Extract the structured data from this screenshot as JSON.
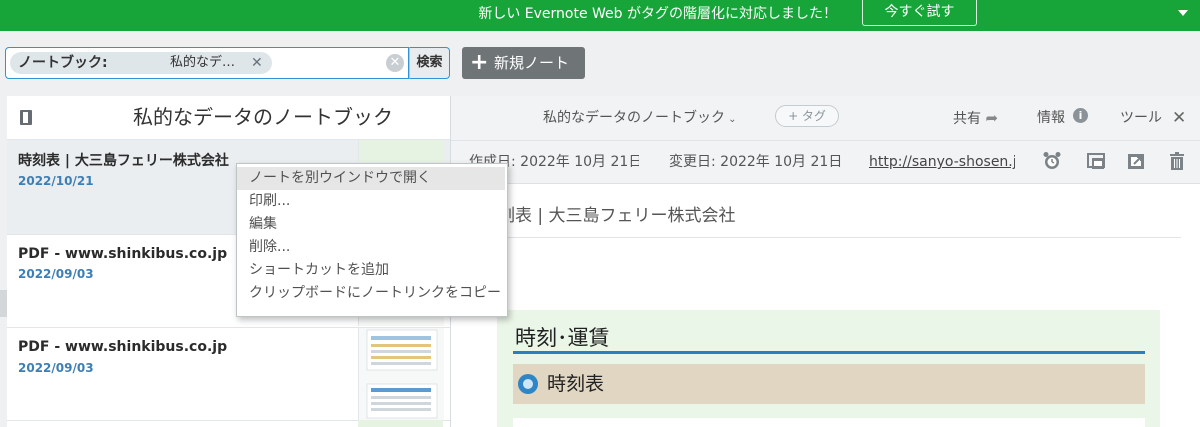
{
  "banner": {
    "message": "新しい Evernote Web がタグの階層化に対応しました！",
    "try_button": "今すぐ試す"
  },
  "toolbar": {
    "filter_key": "ノートブック:",
    "filter_value": "私的なデ…",
    "search_button": "検索",
    "new_note_label": "新規ノート"
  },
  "notebook": {
    "title": "私的なデータのノートブック"
  },
  "notes": [
    {
      "title": "時刻表 | 大三島フェリー株式会社",
      "date": "2022/10/21"
    },
    {
      "title": "PDF - www.shinkibus.co.jp",
      "date": "2022/09/03"
    },
    {
      "title": "PDF - www.shinkibus.co.jp",
      "date": "2022/09/03"
    }
  ],
  "context_menu": [
    "ノートを別ウインドウで開く",
    "印刷...",
    "編集",
    "削除...",
    "ショートカットを追加",
    "クリップボードにノートリンクをコピー"
  ],
  "note_header": {
    "notebook": "私的なデータのノートブック",
    "tag_placeholder": "+ タグ",
    "share": "共有",
    "info": "情報",
    "tools": "ツール"
  },
  "meta": {
    "created": "作成日: 2022年 10月 21日",
    "updated": "変更日: 2022年 10月 21日",
    "url": "http://sanyo-shosen.jp/"
  },
  "document": {
    "title": "時刻表 | 大三島フェリー株式会社",
    "section_heading": "時刻･運賃",
    "subsection": "時刻表"
  },
  "colors": {
    "banner": "#17a53a",
    "date": "#3d7fb5",
    "accent_blue": "#2c7fbf",
    "new_note_bg": "#6f7477"
  }
}
